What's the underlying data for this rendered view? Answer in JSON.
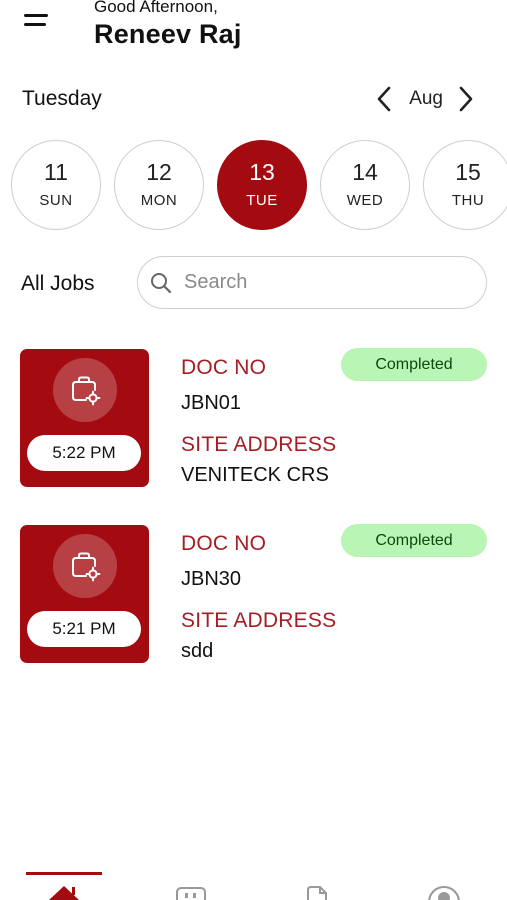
{
  "header": {
    "greeting": "Good Afternoon,",
    "user_name": "Reneev Raj"
  },
  "calendar": {
    "day_label": "Tuesday",
    "month_label": "Aug",
    "dates": [
      {
        "num": "11",
        "dow": "SUN",
        "active": false
      },
      {
        "num": "12",
        "dow": "MON",
        "active": false
      },
      {
        "num": "13",
        "dow": "TUE",
        "active": true
      },
      {
        "num": "14",
        "dow": "WED",
        "active": false
      },
      {
        "num": "15",
        "dow": "THU",
        "active": false
      }
    ]
  },
  "jobs_section": {
    "title": "All Jobs",
    "search_placeholder": "Search"
  },
  "jobs": [
    {
      "doc_label": "DOC NO",
      "doc_no": "JBN01",
      "site_label": "SITE ADDRESS",
      "site_address": "VENITECK CRS",
      "time": "5:22 PM",
      "status": "Completed"
    },
    {
      "doc_label": "DOC NO",
      "doc_no": "JBN30",
      "site_label": "SITE ADDRESS",
      "site_address": "sdd",
      "time": "5:21 PM",
      "status": "Completed"
    }
  ],
  "theme": {
    "accent": "#a30b11",
    "label_red": "#a51e25",
    "status_bg": "#b9f5b4",
    "status_text": "#0e4a10"
  },
  "icons": {
    "menu": "hamburger-icon",
    "prev": "chevron-left-icon",
    "next": "chevron-right-icon",
    "search": "search-icon",
    "job": "briefcase-gear-icon",
    "nav": [
      "home-icon",
      "dashboard-icon",
      "document-icon",
      "profile-icon"
    ]
  }
}
